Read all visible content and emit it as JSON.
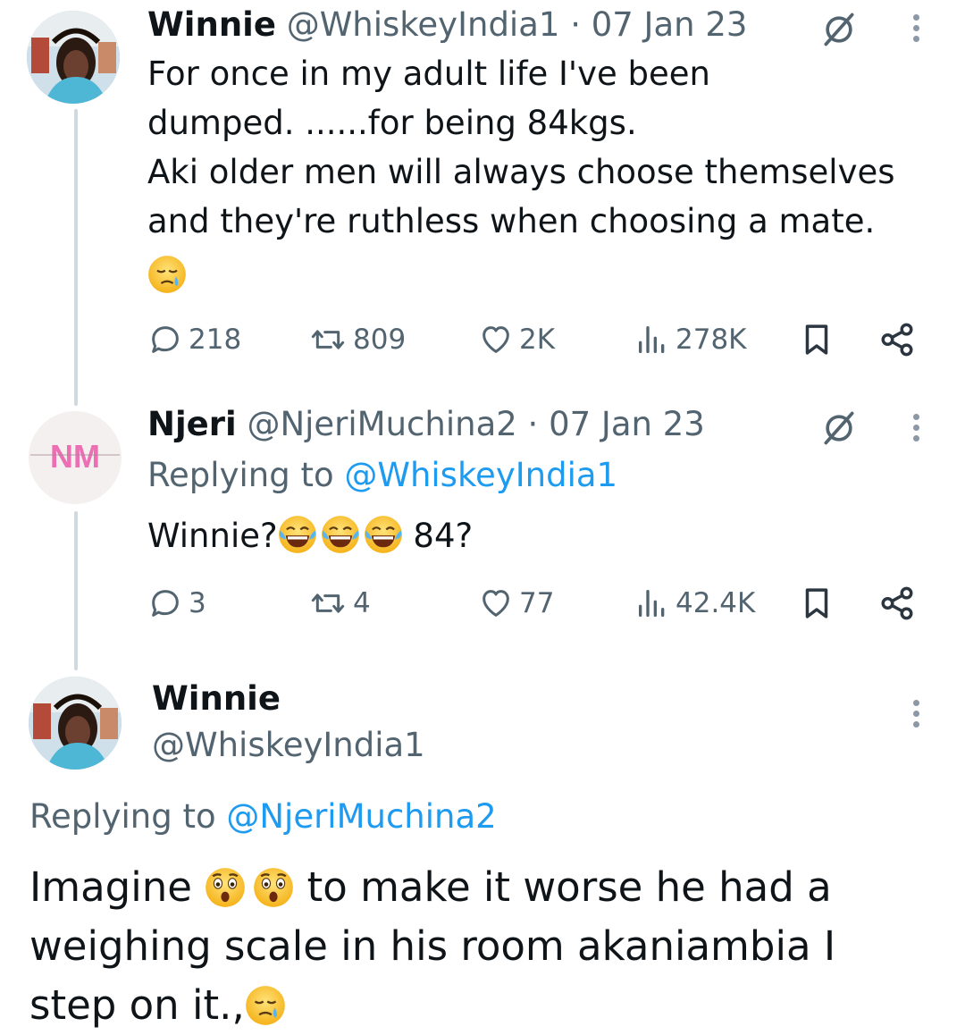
{
  "tweet1": {
    "display_name": "Winnie",
    "handle": "@WhiskeyIndia1",
    "date": "· 07 Jan 23",
    "lines": [
      "For once in my adult life I've been",
      "dumped. ......for being 84kgs.",
      "Aki older men will always choose themselves",
      "and they're ruthless when choosing a mate."
    ],
    "emoji": "sad-tear-emoji",
    "stats": {
      "replies": "218",
      "retweets": "809",
      "likes": "2K",
      "views": "278K"
    }
  },
  "tweet2": {
    "display_name": "Njeri",
    "handle": "@NjeriMuchina2",
    "date": "· 07 Jan 23",
    "replying_prefix": "Replying to ",
    "replying_to": "@WhiskeyIndia1",
    "text_start": "Winnie?",
    "text_end": "84?",
    "avatar_initials": "NM",
    "stats": {
      "replies": "3",
      "retweets": "4",
      "likes": "77",
      "views": "42.4K"
    }
  },
  "tweet3": {
    "display_name": "Winnie",
    "handle": "@WhiskeyIndia1",
    "replying_prefix": "Replying to ",
    "replying_to": "@NjeriMuchina2",
    "line1_start": "Imagine",
    "line1_end": "to make it worse he had a",
    "line2": "weighing scale in his room akaniambia I",
    "line3": "step on it.,"
  },
  "colors": {
    "accent": "#1d9bf0",
    "muted": "#536471",
    "thread": "#cfd9de",
    "nm_pink": "#ec6fb3"
  },
  "icons": [
    "reply-icon",
    "retweet-icon",
    "like-icon",
    "views-icon",
    "bookmark-icon",
    "share-icon",
    "more-icon",
    "edit-history-icon"
  ]
}
